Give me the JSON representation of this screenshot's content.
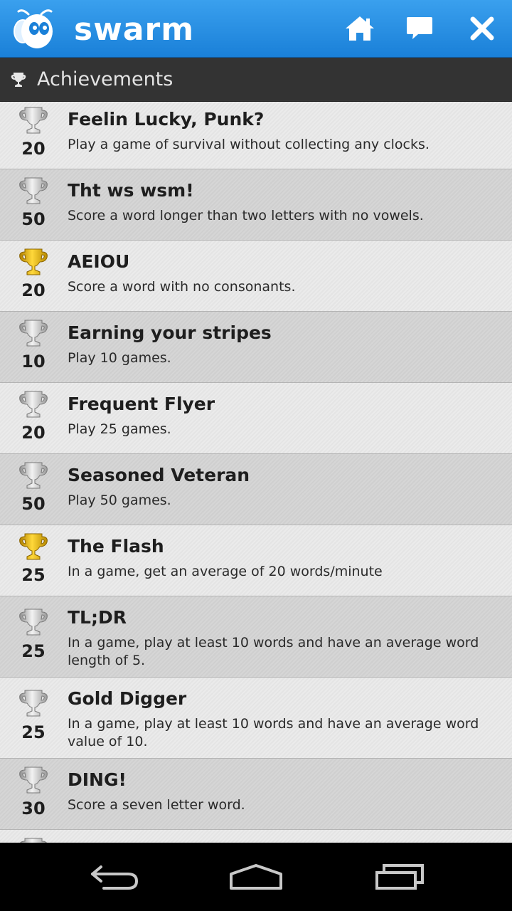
{
  "app": {
    "name": "swarm"
  },
  "section": {
    "title": "Achievements"
  },
  "colors": {
    "header": "#2a8ee6",
    "section_bar": "#333333",
    "gold": "#e2b400",
    "silver": "#b8b8b8"
  },
  "achievements": [
    {
      "points": "20",
      "title": "Feelin Lucky, Punk?",
      "description": "Play a game of survival without collecting any clocks.",
      "unlocked": false
    },
    {
      "points": "50",
      "title": "Tht ws wsm!",
      "description": "Score a word longer than two letters with no vowels.",
      "unlocked": false
    },
    {
      "points": "20",
      "title": "AEIOU",
      "description": "Score a word with no consonants.",
      "unlocked": true
    },
    {
      "points": "10",
      "title": "Earning your stripes",
      "description": "Play 10 games.",
      "unlocked": false
    },
    {
      "points": "20",
      "title": "Frequent Flyer",
      "description": "Play 25 games.",
      "unlocked": false
    },
    {
      "points": "50",
      "title": "Seasoned Veteran",
      "description": "Play 50 games.",
      "unlocked": false
    },
    {
      "points": "25",
      "title": "The Flash",
      "description": "In a game, get an average of 20 words/minute",
      "unlocked": true
    },
    {
      "points": "25",
      "title": "TL;DR",
      "description": "In a game, play at least 10 words and have an average word length of 5.",
      "unlocked": false
    },
    {
      "points": "25",
      "title": "Gold Digger",
      "description": "In a game, play at least 10 words and have an average word value of 10.",
      "unlocked": false
    },
    {
      "points": "30",
      "title": "DING!",
      "description": "Score a seven letter word.",
      "unlocked": false
    }
  ]
}
